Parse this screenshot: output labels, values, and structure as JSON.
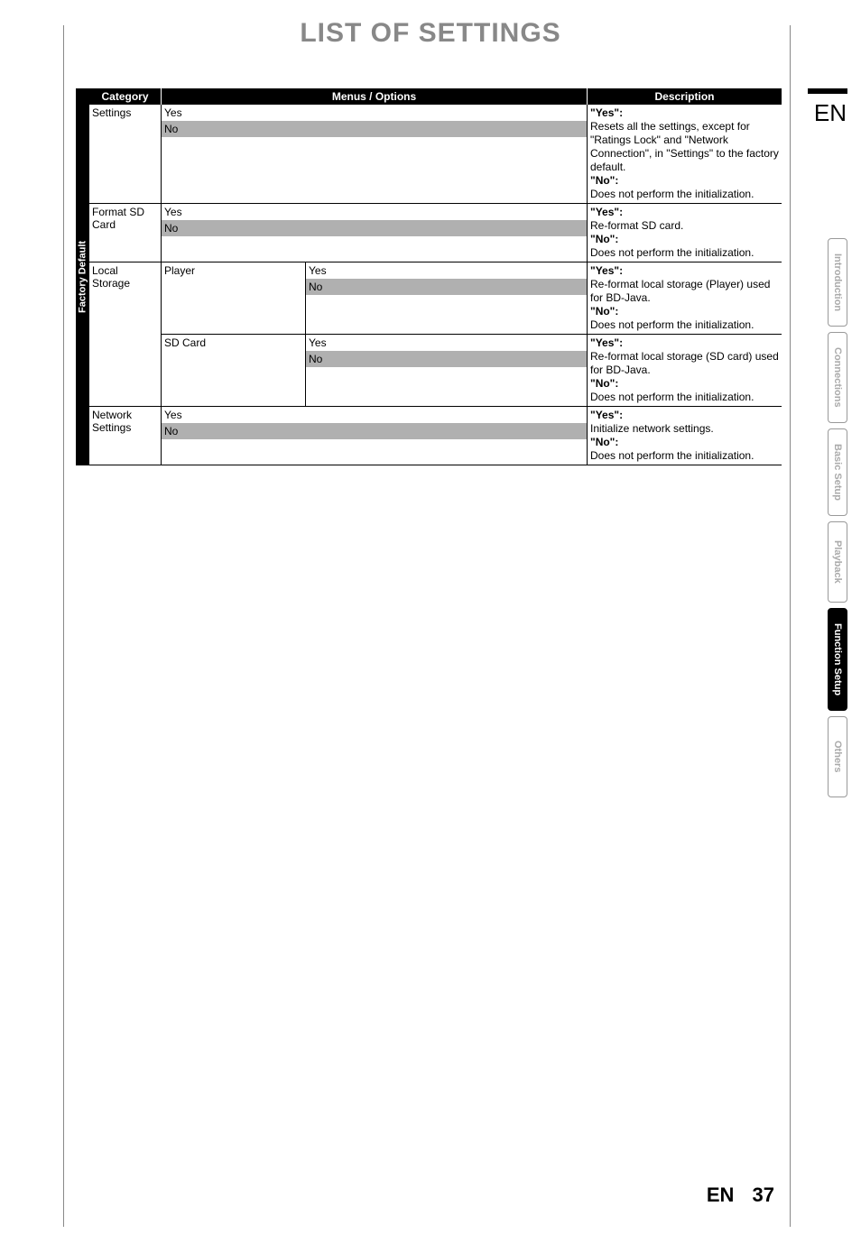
{
  "page_title": "LIST OF SETTINGS",
  "language_badge": "EN",
  "footer": {
    "lang": "EN",
    "page": "37"
  },
  "table": {
    "vertical_category": "Factory Default",
    "headers": {
      "category": "Category",
      "menus": "Menus / Options",
      "description": "Description"
    },
    "rows": [
      {
        "category": "Settings",
        "options": [
          "Yes",
          "No"
        ],
        "shaded_index": 1,
        "description": {
          "yes_label": "\"Yes\":",
          "yes_text": "Resets all the settings, except for \"Ratings Lock\" and \"Network Connection\", in \"Settings\" to the factory default.",
          "no_label": "\"No\":",
          "no_text": "Does not perform the initialization."
        }
      },
      {
        "category": "Format SD Card",
        "options": [
          "Yes",
          "No"
        ],
        "shaded_index": 1,
        "description": {
          "yes_label": "\"Yes\":",
          "yes_text": "Re-format SD card.",
          "no_label": "\"No\":",
          "no_text": "Does not perform the initialization."
        }
      },
      {
        "category": "Local Storage",
        "sub": [
          {
            "label": "Player",
            "options": [
              "Yes",
              "No"
            ],
            "shaded_index": 1,
            "description": {
              "yes_label": "\"Yes\":",
              "yes_text": "Re-format local storage (Player) used for BD-Java.",
              "no_label": "\"No\":",
              "no_text": "Does not perform the initialization."
            }
          },
          {
            "label": "SD Card",
            "options": [
              "Yes",
              "No"
            ],
            "shaded_index": 1,
            "description": {
              "yes_label": "\"Yes\":",
              "yes_text": "Re-format local storage (SD card) used for BD-Java.",
              "no_label": "\"No\":",
              "no_text": "Does not perform the initialization."
            }
          }
        ]
      },
      {
        "category": "Network Settings",
        "options": [
          "Yes",
          "No"
        ],
        "shaded_index": 1,
        "description": {
          "yes_label": "\"Yes\":",
          "yes_text": "Initialize network settings.",
          "no_label": "\"No\":",
          "no_text": "Does not perform the initialization."
        }
      }
    ]
  },
  "side_tabs": [
    {
      "label": "Introduction",
      "active": false
    },
    {
      "label": "Connections",
      "active": false
    },
    {
      "label": "Basic Setup",
      "active": false
    },
    {
      "label": "Playback",
      "active": false
    },
    {
      "label": "Function Setup",
      "active": true
    },
    {
      "label": "Others",
      "active": false
    }
  ]
}
